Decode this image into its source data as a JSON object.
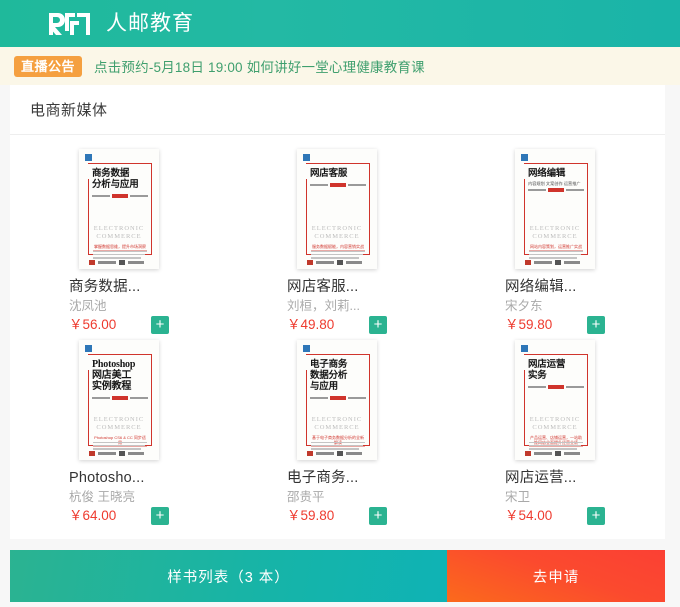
{
  "header": {
    "logo_icon": "ryjy-logo-icon",
    "title": "人邮教育",
    "bg_color": "#1fb99b"
  },
  "notice": {
    "tag": "直播公告",
    "text": "点击预约-5月18日 19:00 如何讲好一堂心理健康教育课",
    "tag_color": "#f5a040",
    "text_color": "#3f9f6e",
    "bg_color": "#fbf7e8"
  },
  "section": {
    "title": "电商新媒体"
  },
  "books": [
    {
      "name": "商务数据...",
      "author": "沈凤池",
      "price": "￥56.00",
      "add_label": "+",
      "cover": {
        "title": "商务数据\n分析与应用",
        "title_lines": [
          "商务数据",
          "分析与应用"
        ],
        "subtitle": "",
        "series": "ELECTRONIC COMMERCE",
        "tagline": "掌握数据思维，提升市场洞察",
        "latin": false
      }
    },
    {
      "name": "网店客服...",
      "author": "刘桓，刘莉...",
      "price": "￥49.80",
      "add_label": "+",
      "cover": {
        "title_lines": [
          "网店客服"
        ],
        "subtitle": "",
        "series": "ELECTRONIC COMMERCE",
        "tagline": "服务数据赋能，内容营销实战",
        "latin": false
      }
    },
    {
      "name": "网络编辑...",
      "author": "宋夕东",
      "price": "￥59.80",
      "add_label": "+",
      "cover": {
        "title_lines": [
          "网络编辑"
        ],
        "subtitle": "内容规划 文案创作 运营推广",
        "series": "ELECTRONIC COMMERCE",
        "tagline": "网站内容策划，运营推广实战",
        "latin": false
      }
    },
    {
      "name": "Photosho...",
      "author": "杭俊 王晓亮",
      "price": "￥64.00",
      "add_label": "+",
      "cover": {
        "title_lines": [
          "Photoshop",
          "网店美工",
          "实例教程"
        ],
        "subtitle": "",
        "series": "ELECTRONIC COMMERCE",
        "tagline": "Photoshop CS6 & CC 同步适用",
        "latin": true
      }
    },
    {
      "name": "电子商务...",
      "author": "邵贵平",
      "price": "￥59.80",
      "add_label": "+",
      "cover": {
        "title_lines": [
          "电子商务",
          "数据分析",
          "与应用"
        ],
        "subtitle": "",
        "series": "ELECTRONIC COMMERCE",
        "tagline": "基于电子商务数据分析的全新解读",
        "latin": false
      }
    },
    {
      "name": "网店运营...",
      "author": "宋卫",
      "price": "￥54.00",
      "add_label": "+",
      "cover": {
        "title_lines": [
          "网店运营",
          "实务"
        ],
        "subtitle": "",
        "series": "ELECTRONIC COMMERCE",
        "tagline": "产品运营、店铺运营，一站助推网店全面提升经营业绩",
        "latin": false
      }
    }
  ],
  "action_bar": {
    "list_label": "样书列表（3 本）",
    "list_color": "#16b4a8",
    "apply_label": "去申请",
    "apply_color": "#fb4a2e"
  }
}
